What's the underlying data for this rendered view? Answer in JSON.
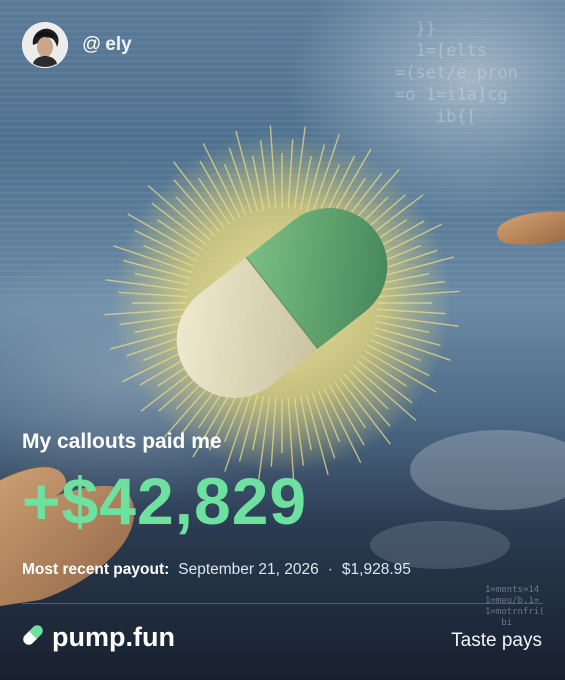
{
  "user": {
    "at_symbol": "@",
    "handle": "ely"
  },
  "background_code": "  }}\n  1=[elts\n=(set/e_pron\n=o 1=i1a]cg\n    ib{[\n",
  "background_code_small": "1=ments=14\n1=meu/b.1=\n1=motrnfri(\n   bi",
  "headline": "My callouts paid me",
  "amount": "+$42,829",
  "payout": {
    "label": "Most recent payout:",
    "date": "September 21, 2026",
    "separator": "·",
    "value": "$1,928.95"
  },
  "footer": {
    "brand": "pump.fun",
    "tagline": "Taste pays"
  },
  "colors": {
    "accent_green": "#6ee0a0",
    "pill_green": "#5aa06a",
    "pill_cream": "#e8e2c4",
    "sun_yellow": "#e8d878"
  },
  "icons": {
    "brand_icon": "pill-icon"
  }
}
